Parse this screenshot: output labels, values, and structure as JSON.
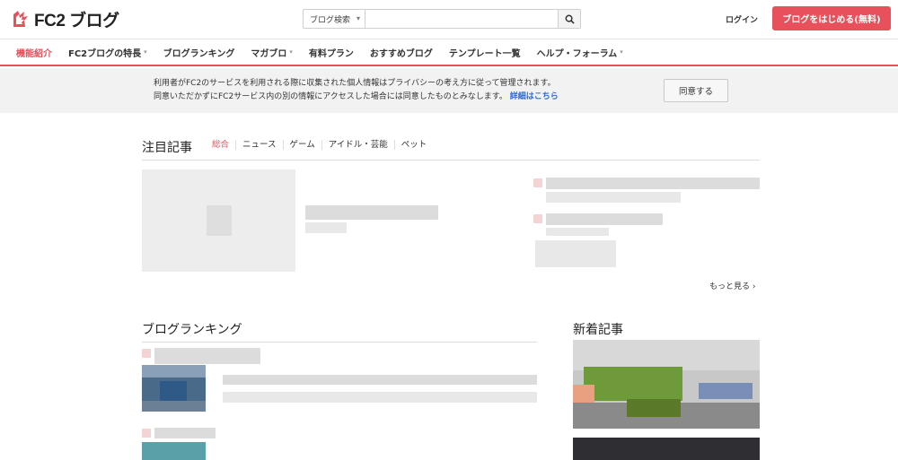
{
  "header": {
    "logo_text": "FC2 ブログ",
    "search": {
      "select_label": "ブログ検索",
      "input_value": "",
      "input_placeholder": ""
    },
    "login_label": "ログイン",
    "start_button_label": "ブログをはじめる(無料)"
  },
  "nav": {
    "items": [
      {
        "label": "機能紹介",
        "active": true,
        "dropdown": false
      },
      {
        "label": "FC2ブログの特長",
        "active": false,
        "dropdown": true
      },
      {
        "label": "ブログランキング",
        "active": false,
        "dropdown": false
      },
      {
        "label": "マガブロ",
        "active": false,
        "dropdown": true
      },
      {
        "label": "有料プラン",
        "active": false,
        "dropdown": false
      },
      {
        "label": "おすすめブログ",
        "active": false,
        "dropdown": false
      },
      {
        "label": "テンプレート一覧",
        "active": false,
        "dropdown": false
      },
      {
        "label": "ヘルプ・フォーラム",
        "active": false,
        "dropdown": true
      }
    ]
  },
  "cookie": {
    "line1": "利用者がFC2のサービスを利用される際に収集された個人情報はプライバシーの考え方に従って管理されます。",
    "line2": "同意いただかずにFC2サービス内の別の情報にアクセスした場合には同意したものとみなします。",
    "link_label": "詳細はこちら",
    "agree_label": "同意する"
  },
  "featured": {
    "title": "注目記事",
    "tabs": [
      "総合",
      "ニュース",
      "ゲーム",
      "アイドル・芸能",
      "ペット"
    ],
    "more_label": "もっと見る"
  },
  "ranking": {
    "title": "ブログランキング"
  },
  "new_articles": {
    "title": "新着記事"
  },
  "colors": {
    "accent": "#e8505b",
    "link": "#2a6ad3",
    "cookie_bg": "#f2f2f2"
  }
}
